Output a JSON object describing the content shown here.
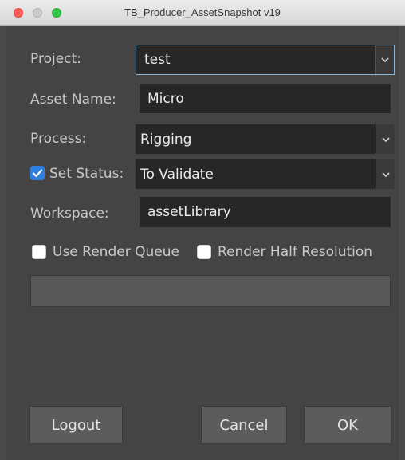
{
  "window": {
    "title": "TB_Producer_AssetSnapshot v19"
  },
  "form": {
    "project": {
      "label": "Project:",
      "value": "test"
    },
    "asset_name": {
      "label": "Asset Name:",
      "value": "Micro"
    },
    "process": {
      "label": "Process:",
      "value": "Rigging"
    },
    "set_status": {
      "label": "Set Status:",
      "value": "To Validate",
      "checked": true
    },
    "workspace": {
      "label": "Workspace:",
      "value": "assetLibrary"
    },
    "use_render_queue": {
      "label": "Use Render Queue",
      "checked": false
    },
    "render_half_resolution": {
      "label": "Render Half Resolution",
      "checked": false
    }
  },
  "buttons": {
    "logout": "Logout",
    "cancel": "Cancel",
    "ok": "OK"
  },
  "colors": {
    "accent_check": "#2f7fe0",
    "focus_border": "#8fb7d3",
    "background": "#444444"
  },
  "icons": {
    "dropdown": "chevron-down-icon",
    "checkmark": "checkmark-icon"
  }
}
